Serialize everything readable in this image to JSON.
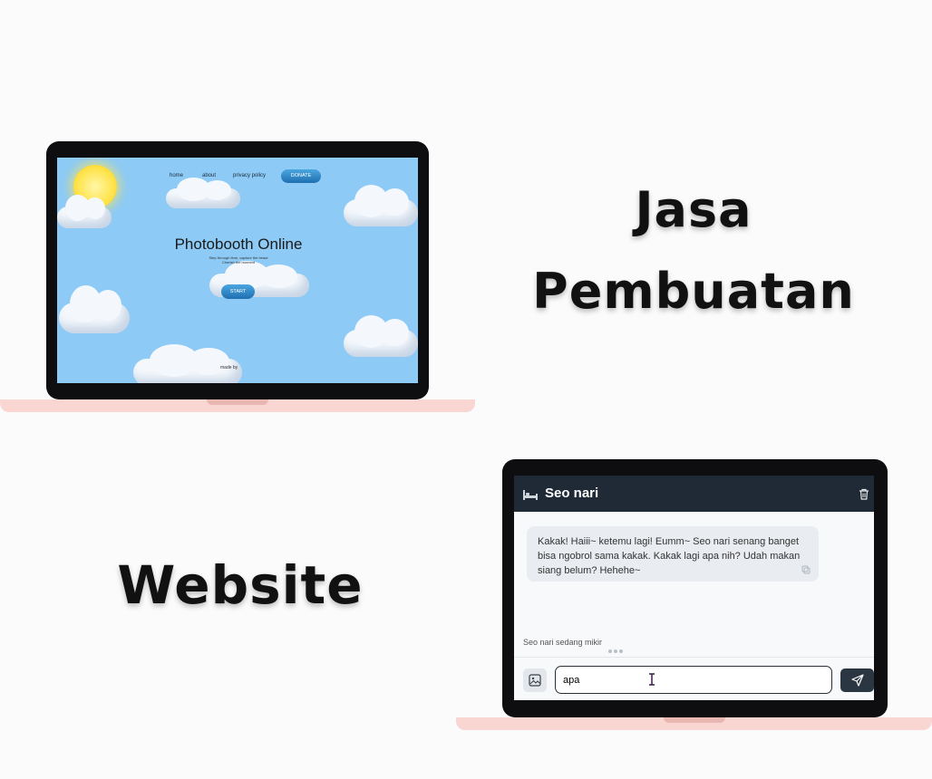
{
  "headline": {
    "line1": "Jasa",
    "line2": "Pembuatan",
    "line3": "Website"
  },
  "photobooth": {
    "nav": [
      "home",
      "about",
      "privacy policy"
    ],
    "donate_label": "DONATE",
    "title": "Photobooth Online",
    "subtitle_line1": "Step through time, capture the beaut",
    "subtitle_line2": "Cherish the moment",
    "start_label": "START",
    "made_by": "made by"
  },
  "chat": {
    "title": "Seo nari",
    "message": "Kakak! Haiii~ ketemu lagi! Eumm~ Seo nari senang banget bisa ngobrol sama kakak. Kakak lagi apa nih? Udah makan siang belum? Hehehe~",
    "typing_status": "Seo nari sedang mikir",
    "input_value": "apa",
    "icons": {
      "header": "bed-icon",
      "delete": "trash-icon",
      "copy": "copy-icon",
      "image": "image-icon",
      "send": "send-icon",
      "cursor": "text-cursor-icon"
    }
  },
  "colors": {
    "laptop_bezel": "#0e0e10",
    "laptop_base": "#f9d6d2",
    "sky": "#8dcaf5",
    "chat_header": "#1f2a36",
    "send_button": "#2b3643"
  }
}
